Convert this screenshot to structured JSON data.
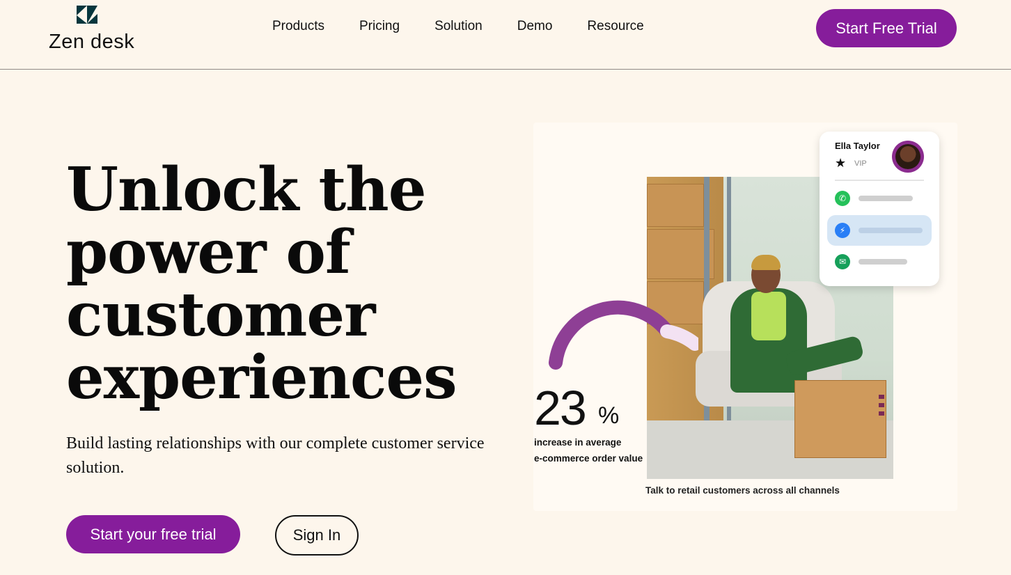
{
  "brand": {
    "name": "Zen desk",
    "accent": "#861d9b",
    "logo_color": "#06363d"
  },
  "nav": {
    "items": [
      "Products",
      "Pricing",
      "Solution",
      "Demo",
      "Resource"
    ],
    "cta": "Start Free Trial"
  },
  "hero": {
    "title": "Unlock the power of customer experiences",
    "subtitle": "Build lasting relationships with our complete customer service solution.",
    "primary_button": "Start your free trial",
    "secondary_button": "Sign In"
  },
  "visual": {
    "stat_value": "23",
    "stat_unit": "%",
    "stat_caption_line1": "increase in average",
    "stat_caption_line2": "e-commerce order value",
    "caption": "Talk to retail customers across all channels",
    "profile": {
      "name": "Ella Taylor",
      "badge": "VIP",
      "channels": [
        {
          "icon": "whatsapp-icon",
          "color": "#25c15a"
        },
        {
          "icon": "messenger-icon",
          "color": "#2a7ff6"
        },
        {
          "icon": "email-icon",
          "color": "#16a05a"
        }
      ]
    }
  }
}
